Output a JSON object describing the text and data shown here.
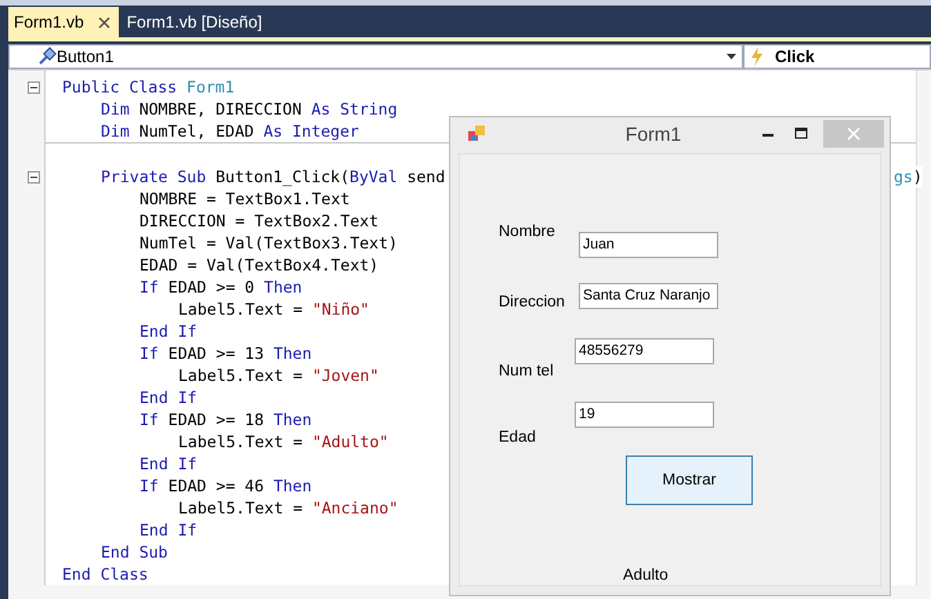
{
  "tabs": [
    {
      "label": "Form1.vb",
      "selected": true,
      "closable": true
    },
    {
      "label": "Form1.vb [Diseño]",
      "selected": false,
      "closable": false
    }
  ],
  "nav_bar": {
    "object": "Button1",
    "event": "Click"
  },
  "code": [
    {
      "fold": true,
      "tokens": [
        {
          "text": "Public Class ",
          "kind": "keyword"
        },
        {
          "text": "Form1",
          "kind": "type"
        }
      ],
      "children": [
        {
          "fold": false,
          "tokens": [
            {
              "text": "Dim ",
              "kind": "keyword"
            },
            {
              "text": "NOMBRE, DIRECCION ",
              "kind": "plain"
            },
            {
              "text": "As String",
              "kind": "keyword"
            }
          ]
        },
        {
          "fold": false,
          "separator": true,
          "tokens": [
            {
              "text": "Dim ",
              "kind": "keyword"
            },
            {
              "text": "NumTel, EDAD ",
              "kind": "plain"
            },
            {
              "text": "As Integer",
              "kind": "keyword"
            }
          ]
        },
        {
          "fold": true,
          "tokens": [
            {
              "text": "Private Sub ",
              "kind": "keyword"
            },
            {
              "text": "Button1_Click(",
              "kind": "plain"
            },
            {
              "text": "ByVal ",
              "kind": "keyword"
            },
            {
              "text": "send",
              "kind": "plain"
            }
          ],
          "tail": [
            {
              "text": "gs",
              "kind": "type"
            },
            {
              "text": ")",
              "kind": "plain"
            }
          ],
          "children": [
            {
              "fold": false,
              "tokens": [
                {
                  "text": "NOMBRE = TextBox1.Text",
                  "kind": "plain"
                }
              ]
            },
            {
              "fold": false,
              "tokens": [
                {
                  "text": "DIRECCION = TextBox2.Text",
                  "kind": "plain"
                }
              ]
            },
            {
              "fold": false,
              "tokens": [
                {
                  "text": "NumTel = Val(TextBox3.Text)",
                  "kind": "plain"
                }
              ]
            },
            {
              "fold": false,
              "tokens": [
                {
                  "text": "EDAD = Val(TextBox4.Text)",
                  "kind": "plain"
                }
              ]
            },
            {
              "fold": false,
              "tokens": [
                {
                  "text": "If ",
                  "kind": "keyword"
                },
                {
                  "text": "EDAD >= 0 ",
                  "kind": "plain"
                },
                {
                  "text": "Then",
                  "kind": "keyword"
                }
              ],
              "children": [
                {
                  "fold": false,
                  "tokens": [
                    {
                      "text": "Label5.Text = ",
                      "kind": "plain"
                    },
                    {
                      "text": "\"Niño\"",
                      "kind": "string"
                    }
                  ]
                }
              ]
            },
            {
              "fold": false,
              "tokens": [
                {
                  "text": "End If",
                  "kind": "keyword"
                }
              ]
            },
            {
              "fold": false,
              "tokens": [
                {
                  "text": "If ",
                  "kind": "keyword"
                },
                {
                  "text": "EDAD >= 13 ",
                  "kind": "plain"
                },
                {
                  "text": "Then",
                  "kind": "keyword"
                }
              ],
              "children": [
                {
                  "fold": false,
                  "tokens": [
                    {
                      "text": "Label5.Text = ",
                      "kind": "plain"
                    },
                    {
                      "text": "\"Joven\"",
                      "kind": "string"
                    }
                  ]
                }
              ]
            },
            {
              "fold": false,
              "tokens": [
                {
                  "text": "End If",
                  "kind": "keyword"
                }
              ]
            },
            {
              "fold": false,
              "tokens": [
                {
                  "text": "If ",
                  "kind": "keyword"
                },
                {
                  "text": "EDAD >= 18 ",
                  "kind": "plain"
                },
                {
                  "text": "Then",
                  "kind": "keyword"
                }
              ],
              "children": [
                {
                  "fold": false,
                  "tokens": [
                    {
                      "text": "Label5.Text = ",
                      "kind": "plain"
                    },
                    {
                      "text": "\"Adulto\"",
                      "kind": "string"
                    }
                  ]
                }
              ]
            },
            {
              "fold": false,
              "tokens": [
                {
                  "text": "End If",
                  "kind": "keyword"
                }
              ]
            },
            {
              "fold": false,
              "tokens": [
                {
                  "text": "If ",
                  "kind": "keyword"
                },
                {
                  "text": "EDAD >= 46 ",
                  "kind": "plain"
                },
                {
                  "text": "Then",
                  "kind": "keyword"
                }
              ],
              "children": [
                {
                  "fold": false,
                  "tokens": [
                    {
                      "text": "Label5.Text = ",
                      "kind": "plain"
                    },
                    {
                      "text": "\"Anciano\"",
                      "kind": "string"
                    }
                  ]
                }
              ]
            },
            {
              "fold": false,
              "tokens": [
                {
                  "text": "End If",
                  "kind": "keyword"
                }
              ]
            }
          ]
        },
        {
          "fold": false,
          "tokens": [
            {
              "text": "End Sub",
              "kind": "keyword"
            }
          ]
        }
      ]
    },
    {
      "fold": false,
      "tokens": [
        {
          "text": "End Class",
          "kind": "keyword"
        }
      ]
    }
  ],
  "form": {
    "title": "Form1",
    "active": false,
    "controls": [
      {
        "kind": "label",
        "text": "Nombre"
      },
      {
        "kind": "textbox",
        "value": "Juan"
      },
      {
        "kind": "label",
        "text": "Direccion"
      },
      {
        "kind": "textbox",
        "value": "Santa Cruz Naranjo"
      },
      {
        "kind": "label",
        "text": "Num tel"
      },
      {
        "kind": "textbox",
        "value": "48556279"
      },
      {
        "kind": "textbox",
        "value": "19"
      },
      {
        "kind": "label",
        "text": "Edad"
      },
      {
        "kind": "button",
        "text": "Mostrar",
        "focused": true
      },
      {
        "kind": "label",
        "text": "Adulto"
      }
    ]
  }
}
